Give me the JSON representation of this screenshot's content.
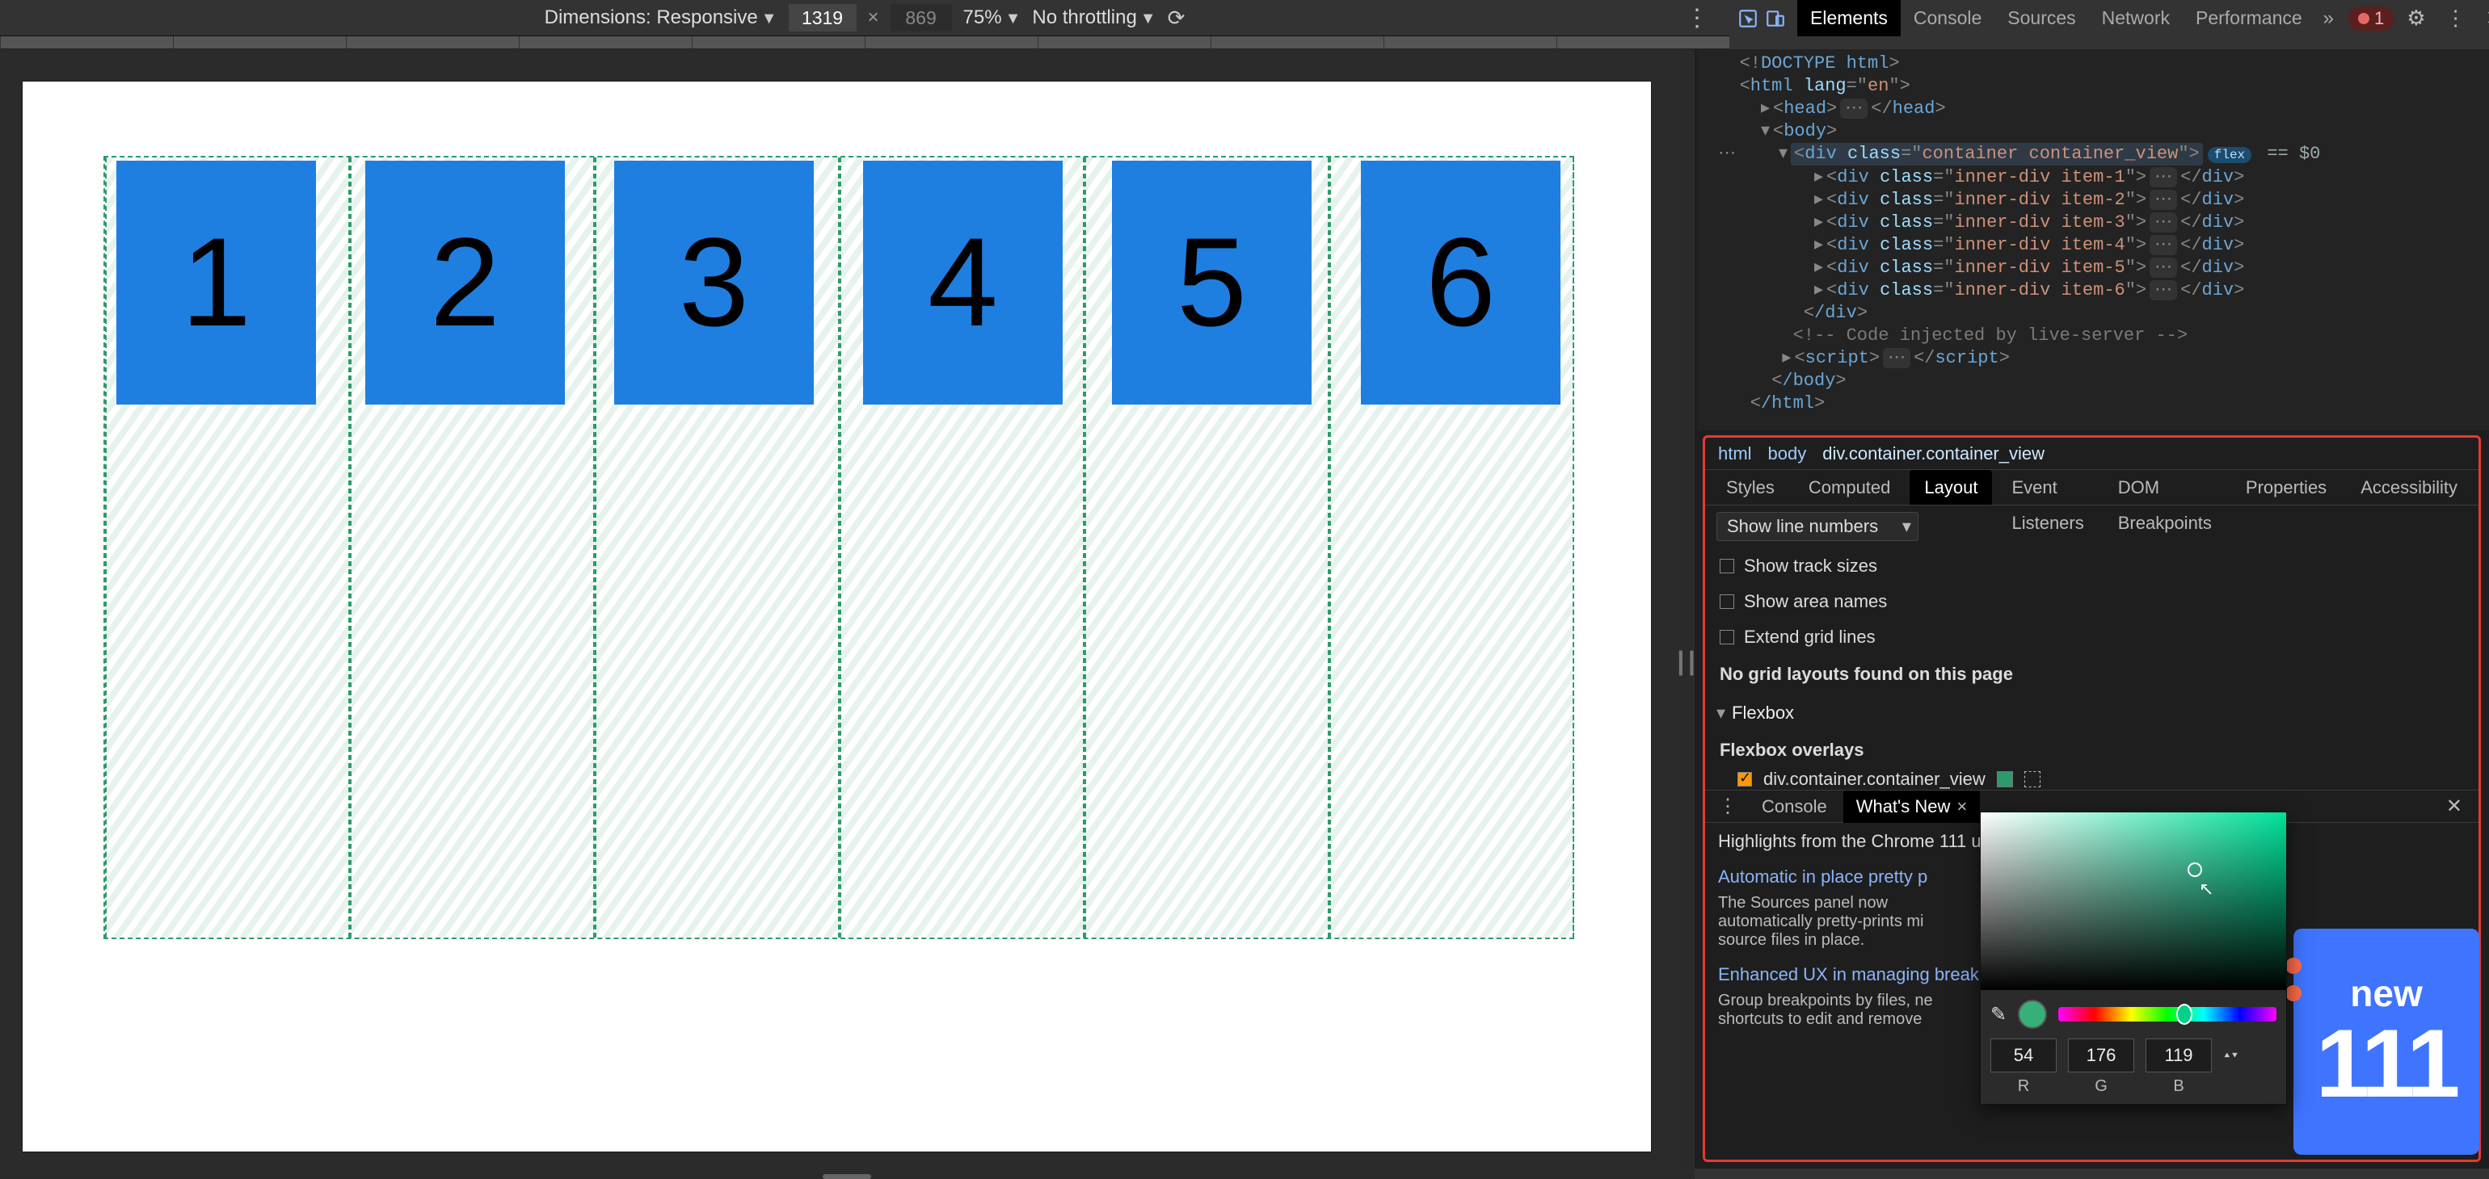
{
  "device_toolbar": {
    "dimensions_label": "Dimensions: Responsive",
    "width": "1319",
    "height": "869",
    "zoom": "75%",
    "throttling": "No throttling"
  },
  "main_panel_tabs": [
    "Elements",
    "Console",
    "Sources",
    "Network",
    "Performance"
  ],
  "main_panel_active": "Elements",
  "error_count": "1",
  "dom": {
    "doctype": "<!DOCTYPE html>",
    "html_open": "html",
    "html_lang_attr": "lang",
    "html_lang_val": "en",
    "head": "head",
    "body": "body",
    "container_class": "container container_view",
    "flex_badge": "flex",
    "eq": "== $0",
    "items": [
      {
        "cls": "inner-div item-1"
      },
      {
        "cls": "inner-div item-2"
      },
      {
        "cls": "inner-div item-3"
      },
      {
        "cls": "inner-div item-4"
      },
      {
        "cls": "inner-div item-5"
      },
      {
        "cls": "inner-div item-6"
      }
    ],
    "div_close": "/div",
    "comment": " Code injected by live-server ",
    "script": "script",
    "body_close": "/body",
    "html_close": "/html"
  },
  "crumbs": [
    "html",
    "body",
    "div.container.container_view"
  ],
  "subtabs": [
    "Styles",
    "Computed",
    "Layout",
    "Event Listeners",
    "DOM Breakpoints",
    "Properties",
    "Accessibility"
  ],
  "subtab_active": "Layout",
  "layout": {
    "dropdown": "Show line numbers",
    "show_track_sizes": "Show track sizes",
    "show_area_names": "Show area names",
    "extend_grid_lines": "Extend grid lines",
    "no_grid_msg": "No grid layouts found on this page",
    "flexbox_header": "Flexbox",
    "flexbox_overlays": "Flexbox overlays",
    "overlay_item": "div.container.container_view"
  },
  "drawer": {
    "tabs": [
      "Console",
      "What's New"
    ],
    "active": "What's New",
    "headline": "Highlights from the Chrome 111 u",
    "item1_title": "Automatic in place pretty p",
    "item1_desc": "The Sources panel now automatically pretty-prints mi source files in place.",
    "item2_title": "Enhanced UX in managing breakpoints",
    "item2_desc": "Group breakpoints by files, ne shortcuts to edit and remove"
  },
  "color_picker": {
    "R": "54",
    "G": "176",
    "B": "119",
    "RL": "R",
    "GL": "G",
    "BL": "B"
  },
  "promo": {
    "new": "new",
    "version": "111"
  },
  "tiles": [
    "1",
    "2",
    "3",
    "4",
    "5",
    "6"
  ]
}
